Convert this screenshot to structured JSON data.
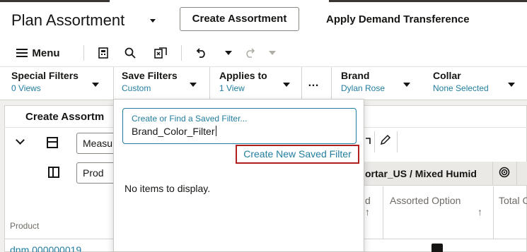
{
  "header": {
    "title": "Plan Assortment",
    "create_button": "Create Assortment",
    "apply_button": "Apply Demand Transference"
  },
  "toolbar": {
    "menu_label": "Menu",
    "icons": [
      "hamburger-icon",
      "grid-export-icon",
      "search-icon",
      "freeze-icon",
      "undo-icon",
      "redo-icon"
    ]
  },
  "filters": [
    {
      "label": "Special Filters",
      "value": "0 Views"
    },
    {
      "label": "Save Filters",
      "value": "Custom"
    },
    {
      "label": "Applies to",
      "value": "1 View"
    },
    {
      "label": "Brand",
      "value": "Dylan Rose"
    },
    {
      "label": "Collar",
      "value": "None Selected"
    }
  ],
  "more_label": "…",
  "background": {
    "panel_title": "Create Assortm",
    "measures_field": "Measu",
    "product_field": "Prod",
    "location_header": "ortar_US / Mixed Humid",
    "col_partial": "d",
    "col_assorted": "Assorted Option",
    "col_total": "Total C",
    "row_label": "Product",
    "row_value": "dnm 000000019"
  },
  "popup": {
    "search_label": "Create or Find a Saved Filter...",
    "search_value": "Brand_Color_Filter",
    "create_link": "Create New Saved Filter",
    "empty_message": "No items to display."
  },
  "colors": {
    "link": "#227e9e",
    "highlight_border": "#b0201f",
    "text": "#161513"
  }
}
